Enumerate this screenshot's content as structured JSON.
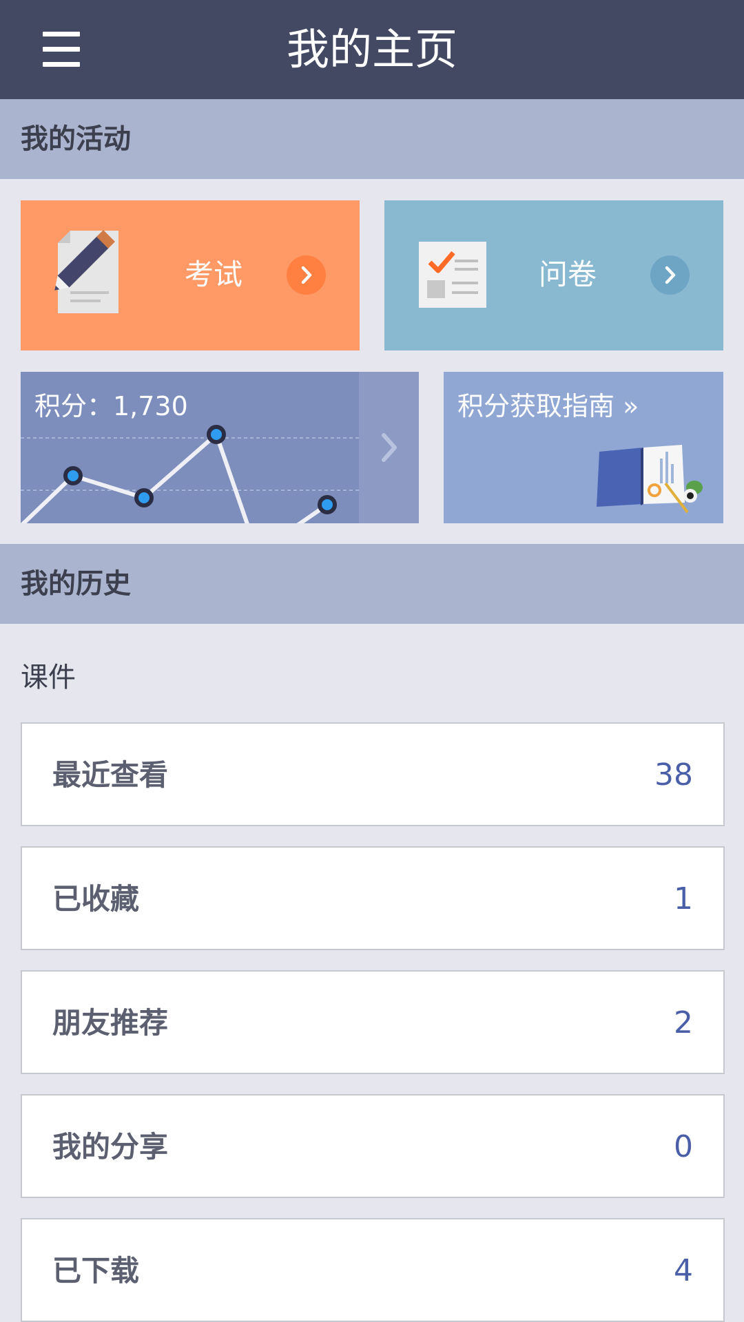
{
  "header": {
    "title": "我的主页",
    "menu_icon": "hamburger-menu-icon"
  },
  "activities": {
    "section_title": "我的活动",
    "exam": {
      "label": "考试",
      "icon": "exam-pencil-icon",
      "color": "#ff9966",
      "arrow_color": "#ff8040"
    },
    "survey": {
      "label": "问卷",
      "icon": "survey-checklist-icon",
      "color": "#89b8d1",
      "arrow_color": "#6fa5c4"
    },
    "points": {
      "label": "积分：1,730"
    },
    "guide": {
      "label": "积分获取指南",
      "suffix": "»",
      "icon": "guide-book-icon"
    }
  },
  "history": {
    "section_title": "我的历史",
    "subtitle": "课件",
    "items": [
      {
        "label": "最近查看",
        "count": "38"
      },
      {
        "label": "已收藏",
        "count": "1"
      },
      {
        "label": "朋友推荐",
        "count": "2"
      },
      {
        "label": "我的分享",
        "count": "0"
      },
      {
        "label": "已下载",
        "count": "4"
      }
    ]
  }
}
